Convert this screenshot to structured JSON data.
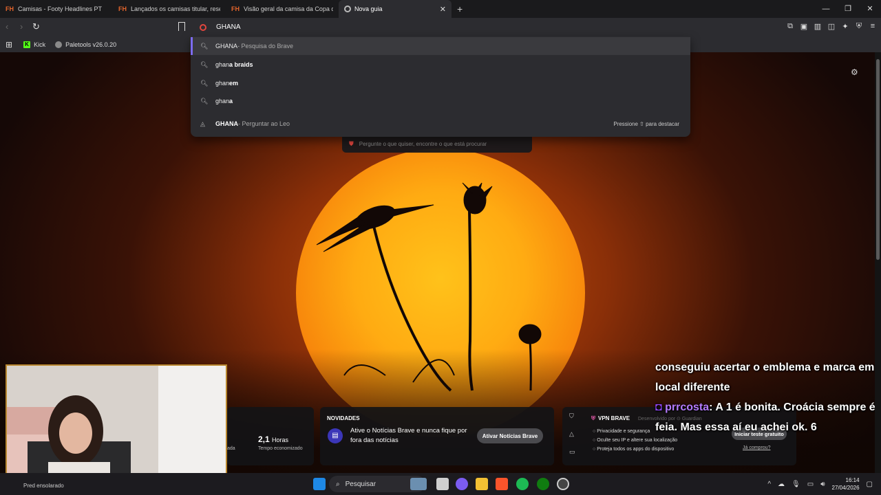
{
  "tabs": [
    {
      "favicon": "FH",
      "label": "Camisas - Footy Headlines PT",
      "active": false
    },
    {
      "favicon": "FH",
      "label": "Lançados os camisas titular, reserva e",
      "active": false
    },
    {
      "favicon": "FH",
      "label": "Visão geral da camisa da Copa do M",
      "active": false
    },
    {
      "favicon": "brave-icon",
      "label": "Nova guia",
      "active": true
    }
  ],
  "toolbar": {
    "address_value": "GHANA"
  },
  "bookmarks": [
    {
      "icon": "kick-icon",
      "label": "Kick"
    },
    {
      "icon": "paletools-icon",
      "label": "Paletools v26.0.20"
    }
  ],
  "suggestions": [
    {
      "icon": "search-icon",
      "bold": "",
      "main": "GHANA",
      "sub": " - Pesquisa do Brave",
      "highlight": true
    },
    {
      "icon": "search-icon",
      "main": "ghan",
      "bold": "a braids",
      "sub": ""
    },
    {
      "icon": "search-icon",
      "main": "ghan",
      "bold": "em",
      "sub": ""
    },
    {
      "icon": "search-icon",
      "main": "ghan",
      "bold": "a",
      "sub": ""
    },
    {
      "icon": "leo-icon",
      "main": "",
      "bold": "GHANA",
      "sub": " - Perguntar ao Leo",
      "hint": "Pressione ⇧ para destacar"
    }
  ],
  "ntp": {
    "leo_placeholder": "Pergunte o que quiser, encontre o que está procurar",
    "stats": {
      "value": "2,1",
      "unit": "Horas",
      "label": "Tempo economizado",
      "left_label": "ada"
    },
    "news": {
      "title": "NOVIDADES",
      "text": "Ative o Notícias Brave e nunca fique por fora das notícias",
      "button": "Ativar Notícias Brave"
    },
    "vpn": {
      "title": "VPN BRAVE",
      "by": "Desenvolvido por ⊙ Guardian",
      "items": [
        "Privacidade e segurança",
        "Oculte seu IP e altere sua localização",
        "Proteja todos os apps do dispositivo"
      ],
      "button": "Iniciar teste gratuito",
      "link": "Já comprou?"
    }
  },
  "chat": {
    "line1": "conseguiu acertar o emblema e marca em local diferente",
    "user": "prrcosta",
    "message": ": A 1 é bonita. Croácia sempre é feia. Mas essa aí eu achei ok. 6"
  },
  "taskbar": {
    "search_label": "Pesquisar",
    "weather": "Pred ensolarado",
    "time": "16:14",
    "date": "27/04/2026"
  },
  "colors": {
    "accent": "#7c6cf0",
    "brave_red": "#e2463e",
    "leo_pink": "#e25aa8",
    "kick_green": "#53fc18"
  }
}
